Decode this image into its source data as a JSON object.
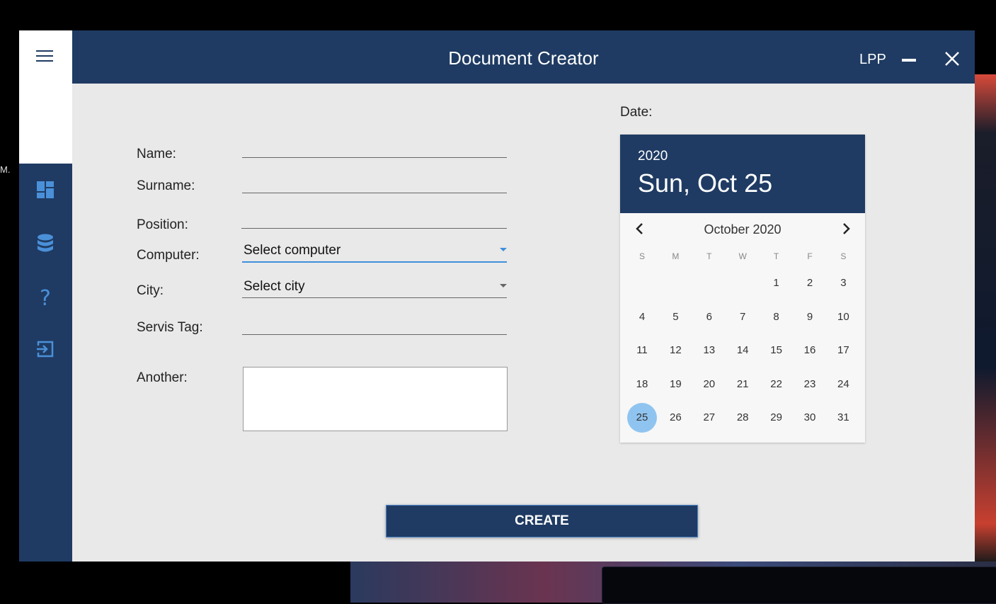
{
  "desktop": {
    "stray_text": "M."
  },
  "window": {
    "title": "Document Creator",
    "user": "LPP",
    "accent_color": "#1f3b63",
    "highlight_color": "#90c4f0"
  },
  "sidebar": {
    "items": [
      {
        "icon": "dashboard-icon"
      },
      {
        "icon": "database-icon"
      },
      {
        "icon": "help-icon"
      },
      {
        "icon": "logout-icon"
      }
    ]
  },
  "form": {
    "name_label": "Name:",
    "surname_label": "Surname:",
    "position_label": "Position:",
    "computer_label": "Computer:",
    "computer_value": "Select computer",
    "city_label": "City:",
    "city_value": "Select city",
    "servis_tag_label": "Servis Tag:",
    "another_label": "Another:"
  },
  "date": {
    "label": "Date:",
    "year": "2020",
    "selected_display": "Sun, Oct 25",
    "month_label": "October 2020",
    "weekdays": [
      "S",
      "M",
      "T",
      "W",
      "T",
      "F",
      "S"
    ],
    "first_weekday_index": 4,
    "days_in_month": 31,
    "selected_day": 25
  },
  "actions": {
    "create_label": "CREATE"
  }
}
